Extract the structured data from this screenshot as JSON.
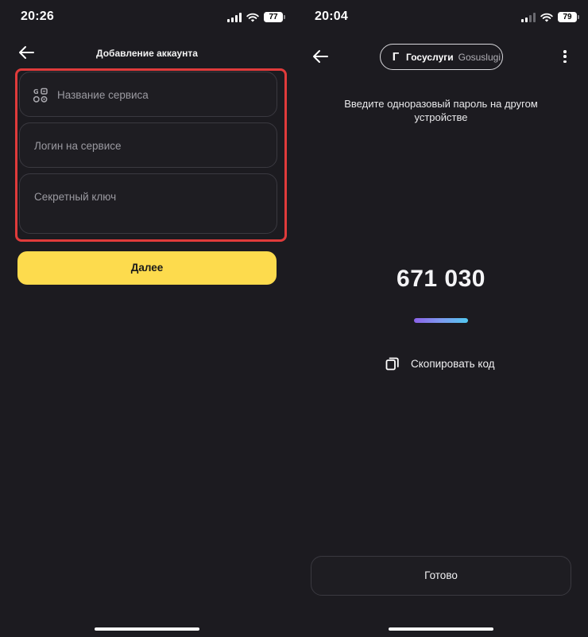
{
  "left": {
    "status": {
      "time": "20:26",
      "battery": "77"
    },
    "header": {
      "title": "Добавление аккаунта"
    },
    "fields": {
      "service_name_placeholder": "Название сервиса",
      "login_placeholder": "Логин на сервисе",
      "secret_key_placeholder": "Секретный ключ"
    },
    "next_button": "Далее",
    "icons": {
      "back": "arrow-left-icon",
      "service": "service-grid-icon"
    },
    "colors": {
      "accent": "#fddb4d",
      "highlight": "#e03b3b",
      "background": "#1c1b20"
    }
  },
  "right": {
    "status": {
      "time": "20:04",
      "battery": "79"
    },
    "service_chip": {
      "logo_letter": "Г",
      "name": "Госуслуги",
      "name_latin": "Gosuslugi"
    },
    "prompt": "Введите одноразовый пароль на другом устройстве",
    "otp_code": "671 030",
    "copy_label": "Скопировать код",
    "done_button": "Готово",
    "icons": {
      "back": "arrow-left-icon",
      "menu": "more-vertical-icon",
      "copy": "copy-icon"
    }
  }
}
